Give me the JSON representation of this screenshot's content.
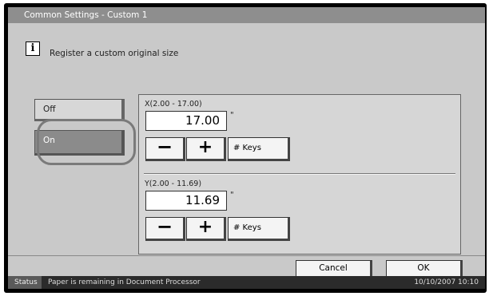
{
  "title": "Common Settings - Custom 1",
  "message": "Register a custom original size",
  "info_icon": "i",
  "options": {
    "off": "Off",
    "on": "On",
    "selected": "On"
  },
  "x_axis": {
    "range": "X(2.00 - 17.00)",
    "value": "17.00",
    "unit": "\""
  },
  "y_axis": {
    "range": "Y(2.00 - 11.69)",
    "value": "11.69",
    "unit": "\""
  },
  "buttons": {
    "minus": "−",
    "plus": "+",
    "keys": "# Keys",
    "cancel": "Cancel",
    "ok": "OK"
  },
  "status": {
    "label": "Status",
    "message": "Paper is remaining in Document Processor",
    "datetime": "10/10/2007   10:10"
  }
}
